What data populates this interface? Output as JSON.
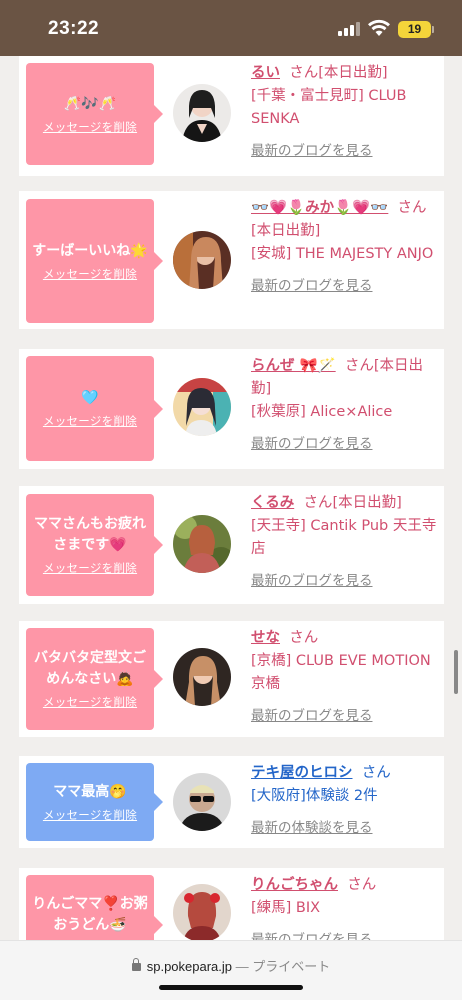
{
  "status_bar": {
    "time": "23:22",
    "battery": "19"
  },
  "common": {
    "delete_label": "メッセージを削除",
    "san_label": "さん",
    "blog_link": "最新のブログを見る",
    "review_link": "最新の体験談を見る"
  },
  "cards": [
    {
      "message": "🥂🎶🥂",
      "name": "るい",
      "status": "[本日出勤]",
      "shop": "[千葉・富士見町] CLUB SENKA"
    },
    {
      "message": "すーばーいいね🌟",
      "name": "👓💗🌷みか🌷💗👓",
      "status": "[本日出勤]",
      "shop": "[安城] THE MAJESTY ANJO"
    },
    {
      "message": "🩵",
      "name": "らんぜ 🎀🪄",
      "status": "[本日出勤]",
      "shop": "[秋葉原] Alice×Alice"
    },
    {
      "message": "ママさんもお疲れさまです💗",
      "name": "くるみ",
      "status": "[本日出勤]",
      "shop": "[天王寺] Cantik Pub 天王寺店"
    },
    {
      "message": "バタバタ定型文ごめんなさい🙇",
      "name": "せな",
      "status": "",
      "shop": "[京橋] CLUB EVE MOTION 京橋"
    },
    {
      "message": "ママ最高🤭",
      "name": "テキ屋のヒロシ",
      "status": "",
      "shop": "[大阪府]体験談 2件"
    },
    {
      "message": "りんごママ❣️お粥おうどん🍜",
      "name": "りんごちゃん",
      "status": "",
      "shop": "[練馬] BIX"
    }
  ],
  "url_bar": {
    "domain": "sp.pokepara.jp",
    "suffix": "— プライベート"
  },
  "colors": {
    "pink_bubble": "#fe96a7",
    "blue_bubble": "#7eaaf3",
    "name_pink": "#d14f6f",
    "name_blue": "#2466c9",
    "status_bar": "#6a5444"
  }
}
